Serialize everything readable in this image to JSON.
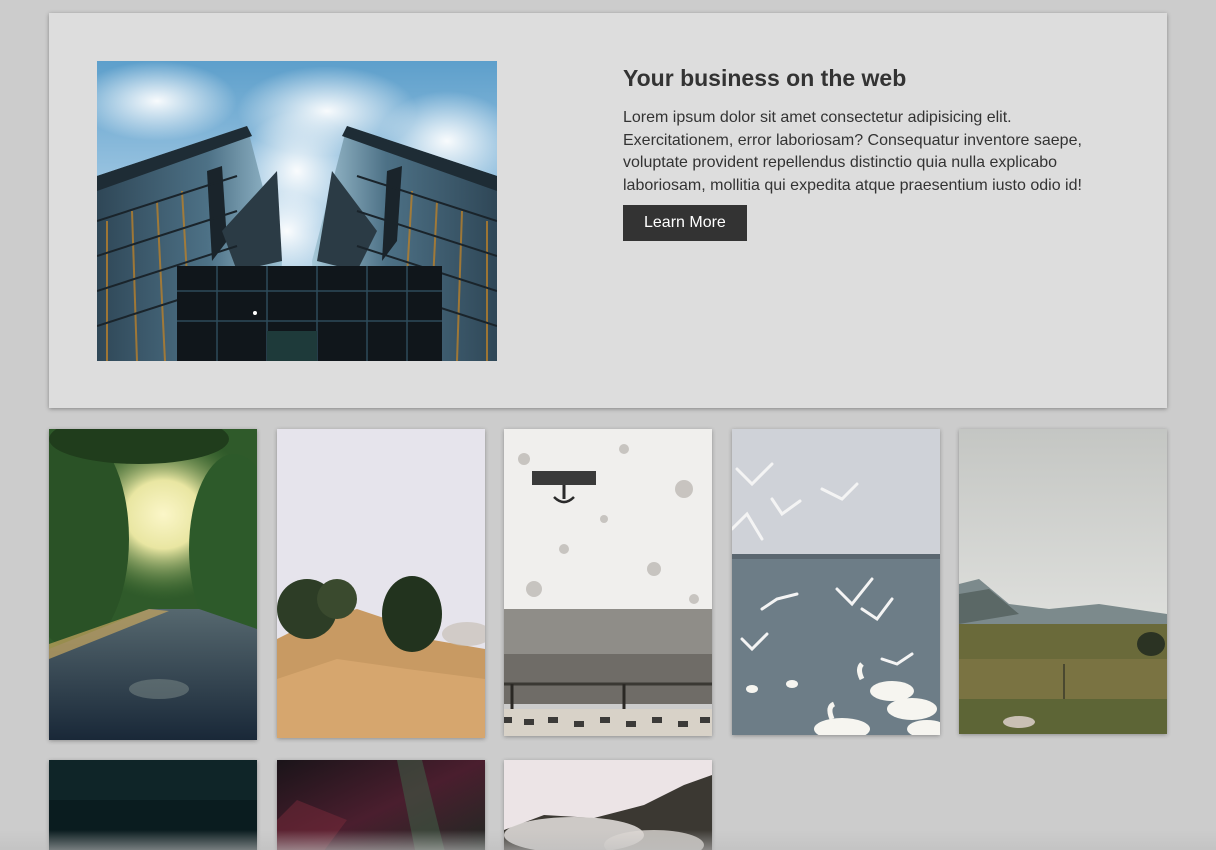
{
  "hero": {
    "image_alt": "Looking up between two glass skyscrapers against a cloudy blue sky",
    "title": "Your business on the web",
    "body": "Lorem ipsum dolor sit amet consectetur adipisicing elit. Exercitationem, error laboriosam? Consequatur inventore saepe, voluptate provident repellendus distinctio quia nulla explicabo laboriosam, mollitia qui expedita atque praesentium iusto odio id!",
    "button_label": "Learn More"
  },
  "gallery": {
    "items": [
      {
        "subject": "sunlit tree-lined road"
      },
      {
        "subject": "sandy dune with shrubs in fog"
      },
      {
        "subject": "weathered white wall with anchor sign above bench"
      },
      {
        "subject": "seagulls and swans over water"
      },
      {
        "subject": "grassy valley under overcast sky"
      },
      {
        "subject": "dark teal image"
      },
      {
        "subject": "aurora night sky"
      },
      {
        "subject": "misty hills"
      }
    ]
  },
  "colors": {
    "page_background": "#cccccc",
    "card_background": "#dddddd",
    "text": "#333333",
    "button_background": "#333333",
    "button_text": "#ffffff"
  }
}
